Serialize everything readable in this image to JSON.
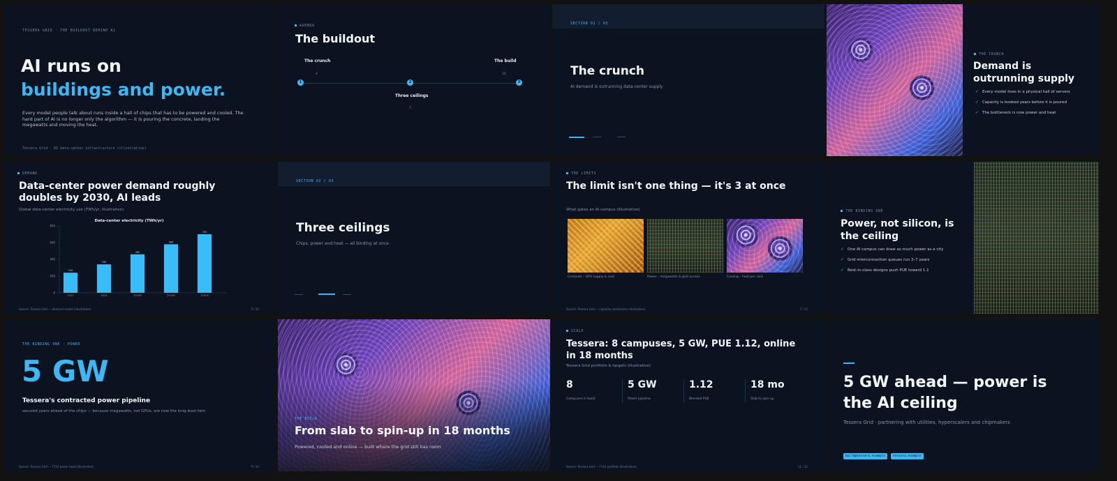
{
  "s1": {
    "kicker": "TESSERA GRID · THE BUILDOUT BEHIND AI",
    "title_line1": "AI runs on",
    "title_line2": "buildings and power.",
    "body": "Every model people talk about runs inside a hall of chips that has to be powered and cooled. The hard part of AI is no longer only the algorithm — it is pouring the concrete, landing the megawatts and moving the heat.",
    "footer": "Tessera Grid · AI data-center infrastructure (illustrative)"
  },
  "s2": {
    "kicker": "AGENDA",
    "title": "The buildout",
    "items": [
      {
        "num": "1",
        "label": "The crunch",
        "page": "4"
      },
      {
        "num": "2",
        "label": "Three ceilings",
        "page": "7"
      },
      {
        "num": "3",
        "label": "The build",
        "page": "10"
      }
    ]
  },
  "s3": {
    "kicker": "SECTION 01 / 03",
    "title": "The crunch",
    "sub": "AI demand is outrunning data-center supply"
  },
  "s4": {
    "kicker": "THE CRUNCH",
    "title": "Demand is outrunning supply",
    "bullets": [
      "Every model lives in a physical hall of servers",
      "Capacity is booked years before it is poured",
      "The bottleneck is now power and heat"
    ]
  },
  "s5": {
    "kicker": "DEMAND",
    "title": "Data-center power demand roughly doubles by 2030, AI leads",
    "sub": "Global data-center electricity use (TWh/yr, illustrative)",
    "footer": "Source: Tessera Grid — demand model (illustrative)",
    "page": "5 / 12"
  },
  "chart_data": {
    "type": "bar",
    "title": "Data-center electricity (TWh/yr)",
    "categories": [
      "2022",
      "2024",
      "2026E",
      "2028E",
      "2030E"
    ],
    "values": [
      240,
      340,
      460,
      580,
      700
    ],
    "data_labels": [
      "240",
      "340",
      "460",
      "580",
      "700"
    ],
    "ylim": [
      0,
      800
    ],
    "yticks": [
      0,
      200,
      400,
      600,
      800
    ],
    "grid": false,
    "color": "#38bdf8"
  },
  "s6": {
    "kicker": "SECTION 02 / 03",
    "title": "Three ceilings",
    "sub": "Chips, power and heat — all binding at once"
  },
  "s7": {
    "kicker": "THE LIMITS",
    "title": "The limit isn't one thing — it's 3 at once",
    "sub": "What gates an AI campus (illustrative)",
    "cards": [
      {
        "caption": "Compute – GPU supply & cost"
      },
      {
        "caption": "Power – megawatts & grid access"
      },
      {
        "caption": "Cooling – heat per rack"
      }
    ],
    "footer": "Source: Tessera Grid — capacity constraints (illustrative)",
    "page": "7 / 12"
  },
  "s8": {
    "kicker": "THE BINDING ONE",
    "title": "Power, not silicon, is the ceiling",
    "bullets": [
      "One AI campus can draw as much power as a city",
      "Grid interconnection queues run 3–7 years",
      "Best-in-class designs push PUE toward 1.1"
    ]
  },
  "s9": {
    "kicker": "THE BINDING ONE · POWER",
    "big": "5 GW",
    "title": "Tessera's contracted power pipeline",
    "sub": "secured years ahead of the chips — because megawatts, not GPUs, are now the long-lead item",
    "footer": "Source: Tessera Grid — FY24 power book (illustrative)",
    "page": "9 / 12"
  },
  "s10": {
    "kicker": "THE BUILD",
    "title": "From slab to spin-up in 18 months",
    "sub": "Powered, cooled and online — built where the grid still has room"
  },
  "s11": {
    "kicker": "SCALE",
    "title": "Tessera: 8 campuses, 5 GW, PUE 1.12, online in 18 months",
    "sub": "Tessera Grid portfolio & targets (illustrative)",
    "stats": [
      {
        "value": "8",
        "label": "Campuses in build"
      },
      {
        "value": "5 GW",
        "label": "Power pipeline"
      },
      {
        "value": "1.12",
        "label": "Blended PUE"
      },
      {
        "value": "18 mo",
        "label": "Slab to spin-up"
      }
    ],
    "footer": "Source: Tessera Grid — FY24 portfolio (illustrative)",
    "page": "11 / 12"
  },
  "s12": {
    "title": "5 GW ahead — power is the AI ceiling",
    "sub": "Tessera Grid · partnering with utilities, hyperscalers and chipmakers",
    "pills": [
      "build@tessera.example",
      "tessera.example"
    ]
  }
}
